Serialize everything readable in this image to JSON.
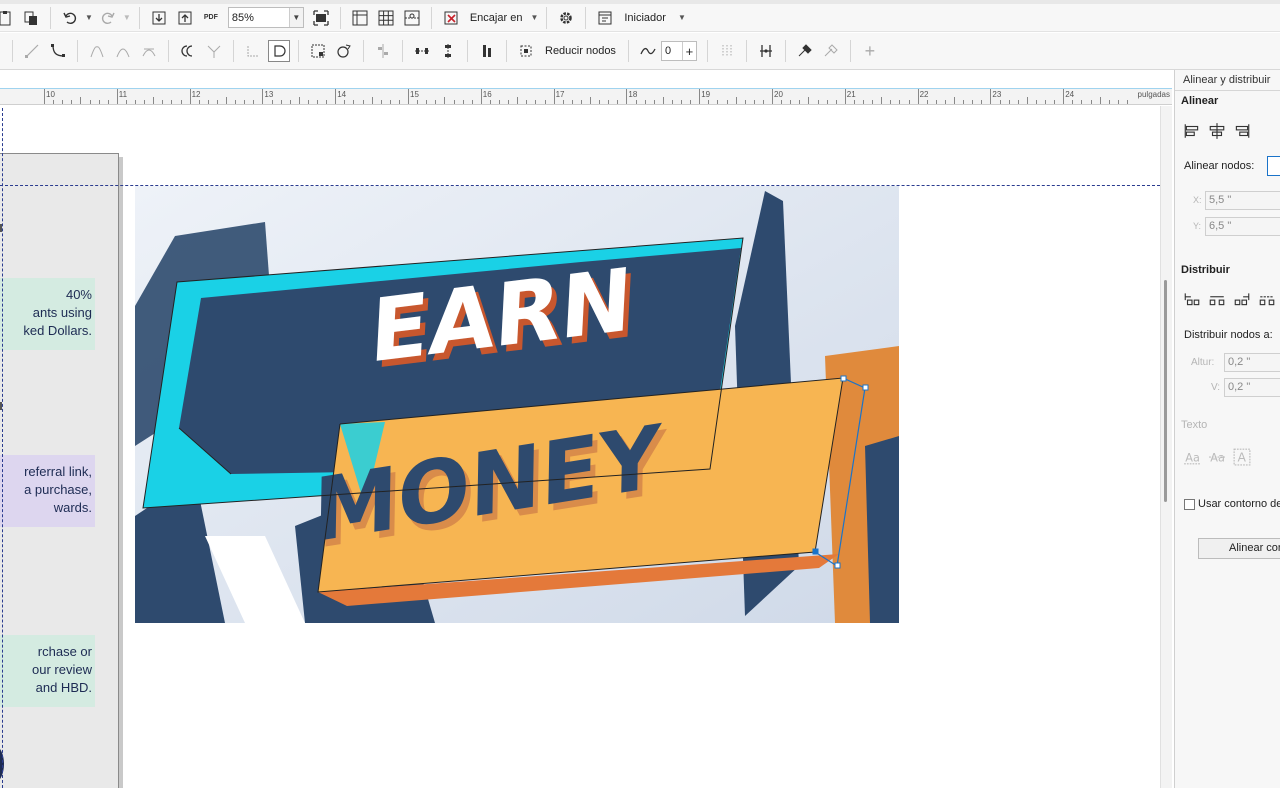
{
  "toolbar_top": {
    "pdf_label": "PDF",
    "zoom_value": "85%",
    "snap_label": "Encajar en",
    "launcher_label": "Iniciador"
  },
  "toolbar_node": {
    "reduce_nodes_label": "Reducir nodos",
    "curve_smoothing_value": "0"
  },
  "ruler": {
    "unit": "pulgadas",
    "labels": [
      "10",
      "11",
      "12",
      "13",
      "14",
      "15",
      "16",
      "17",
      "18",
      "19",
      "20",
      "21",
      "22",
      "23",
      "24"
    ]
  },
  "document": {
    "notes": [
      {
        "text": "40%\nants using\nked Dollars."
      },
      {
        "text": "referral link,\na purchase,\nwards."
      },
      {
        "text": "rchase or\nour review\nand HBD."
      }
    ],
    "artwork": {
      "line1": "EARN",
      "line2": "MONEY",
      "colors": {
        "navy": "#2e4a6e",
        "cyan": "#1ad1e6",
        "orange": "#f7b552",
        "orange_dark": "#e4793a",
        "bg": "#dfe6f1"
      }
    }
  },
  "panel": {
    "title": "Alinear y distribuir",
    "align_section": "Alinear",
    "align_nodes_label": "Alinear nodos:",
    "x_label": "X:",
    "x_value": "5,5 \"",
    "y_label": "Y:",
    "y_value": "6,5 \"",
    "distribute_section": "Distribuir",
    "distribute_nodes_label": "Distribuir nodos a:",
    "height_label": "Altur:",
    "height_value": "0,2 \"",
    "v_label": "V:",
    "v_value": "0,2 \"",
    "text_section": "Texto",
    "use_outline_label": "Usar contorno de",
    "align_button_label": "Alinear con"
  }
}
